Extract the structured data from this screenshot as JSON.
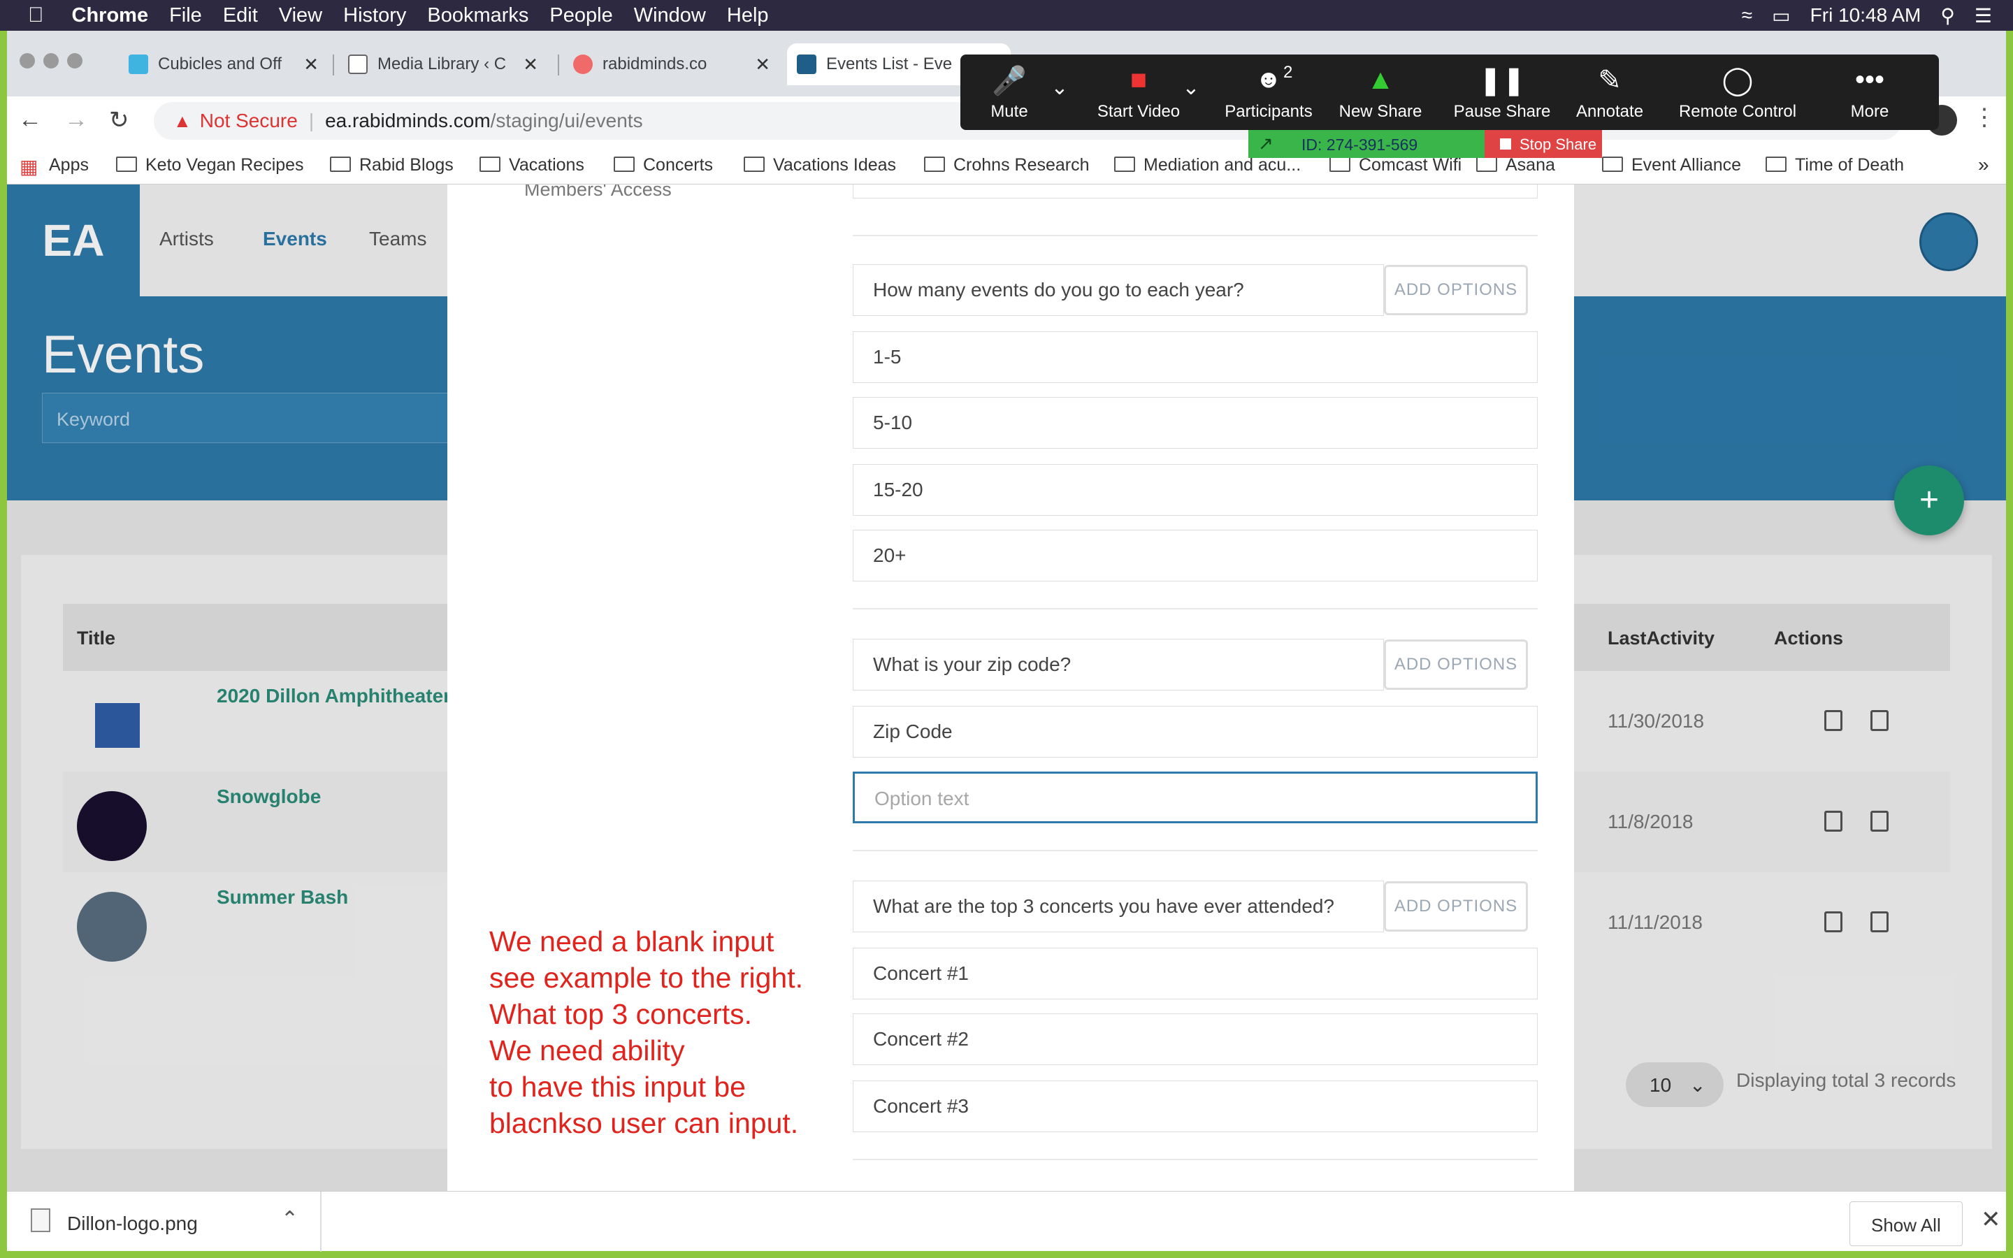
{
  "menubar": {
    "app": "Chrome",
    "items": [
      "File",
      "Edit",
      "View",
      "History",
      "Bookmarks",
      "People",
      "Window",
      "Help"
    ],
    "clock": "Fri 10:48 AM"
  },
  "tabs": [
    {
      "label": "Cubicles and Off",
      "fav_color": "#3fb4e0"
    },
    {
      "label": "Media Library ‹ C",
      "fav_color": "#ffffff"
    },
    {
      "label": "rabidminds.co",
      "fav_color": "#f06a6a"
    },
    {
      "label": "Events List - Eve",
      "fav_color": "#1e5e88"
    }
  ],
  "address": {
    "warning": "Not Secure",
    "domain": "ea.rabidminds.com",
    "path": "/staging/ui/events"
  },
  "bookmarks": [
    "Apps",
    "Keto Vegan Recipes",
    "Rabid Blogs",
    "Vacations",
    "Concerts",
    "Vacations Ideas",
    "Crohns Research",
    "Mediation and acu...",
    "Comcast Wifi",
    "Asana",
    "Event Alliance",
    "Time of Death"
  ],
  "zoom": {
    "mute": "Mute",
    "start_video": "Start Video",
    "participants": "Participants",
    "participant_count": "2",
    "new_share": "New Share",
    "pause_share": "Pause Share",
    "annotate": "Annotate",
    "remote_control": "Remote Control",
    "more": "More",
    "meeting_id": "ID: 274-391-569",
    "stop_share": "Stop Share"
  },
  "app": {
    "logo": "EA",
    "nav": [
      "Artists",
      "Events",
      "Teams"
    ],
    "page_title": "Events",
    "keyword_placeholder": "Keyword",
    "table_headers": {
      "title": "Title",
      "last_activity": "LastActivity",
      "actions": "Actions"
    },
    "rows": [
      {
        "name": "2020 Dillon Amphitheater",
        "date": "11/30/2018"
      },
      {
        "name": "Snowglobe",
        "date": "11/8/2018"
      },
      {
        "name": "Summer Bash",
        "date": "11/11/2018"
      }
    ],
    "page_size": "10",
    "records_text": "Displaying total 3 records",
    "fab": "+"
  },
  "modal": {
    "members_access": "Members' Access",
    "add_options": "ADD OPTIONS",
    "questions": [
      {
        "q": "How many events do you go to each year?",
        "options": [
          "1-5",
          "5-10",
          "15-20",
          "20+"
        ]
      },
      {
        "q": "What is your zip code?",
        "options": [
          "Zip Code"
        ]
      },
      {
        "q": "What are the top 3 concerts you have ever attended?",
        "options": [
          "Concert #1",
          "Concert #2",
          "Concert #3"
        ]
      }
    ],
    "option_placeholder": "Option text",
    "annotation": "We need a blank input\nsee example to the right.\nWhat top 3 concerts.\nWe need ability\nto have this input be\nblacnkso user can input."
  },
  "downloads": {
    "file": "Dillon-logo.png",
    "show_all": "Show All"
  }
}
